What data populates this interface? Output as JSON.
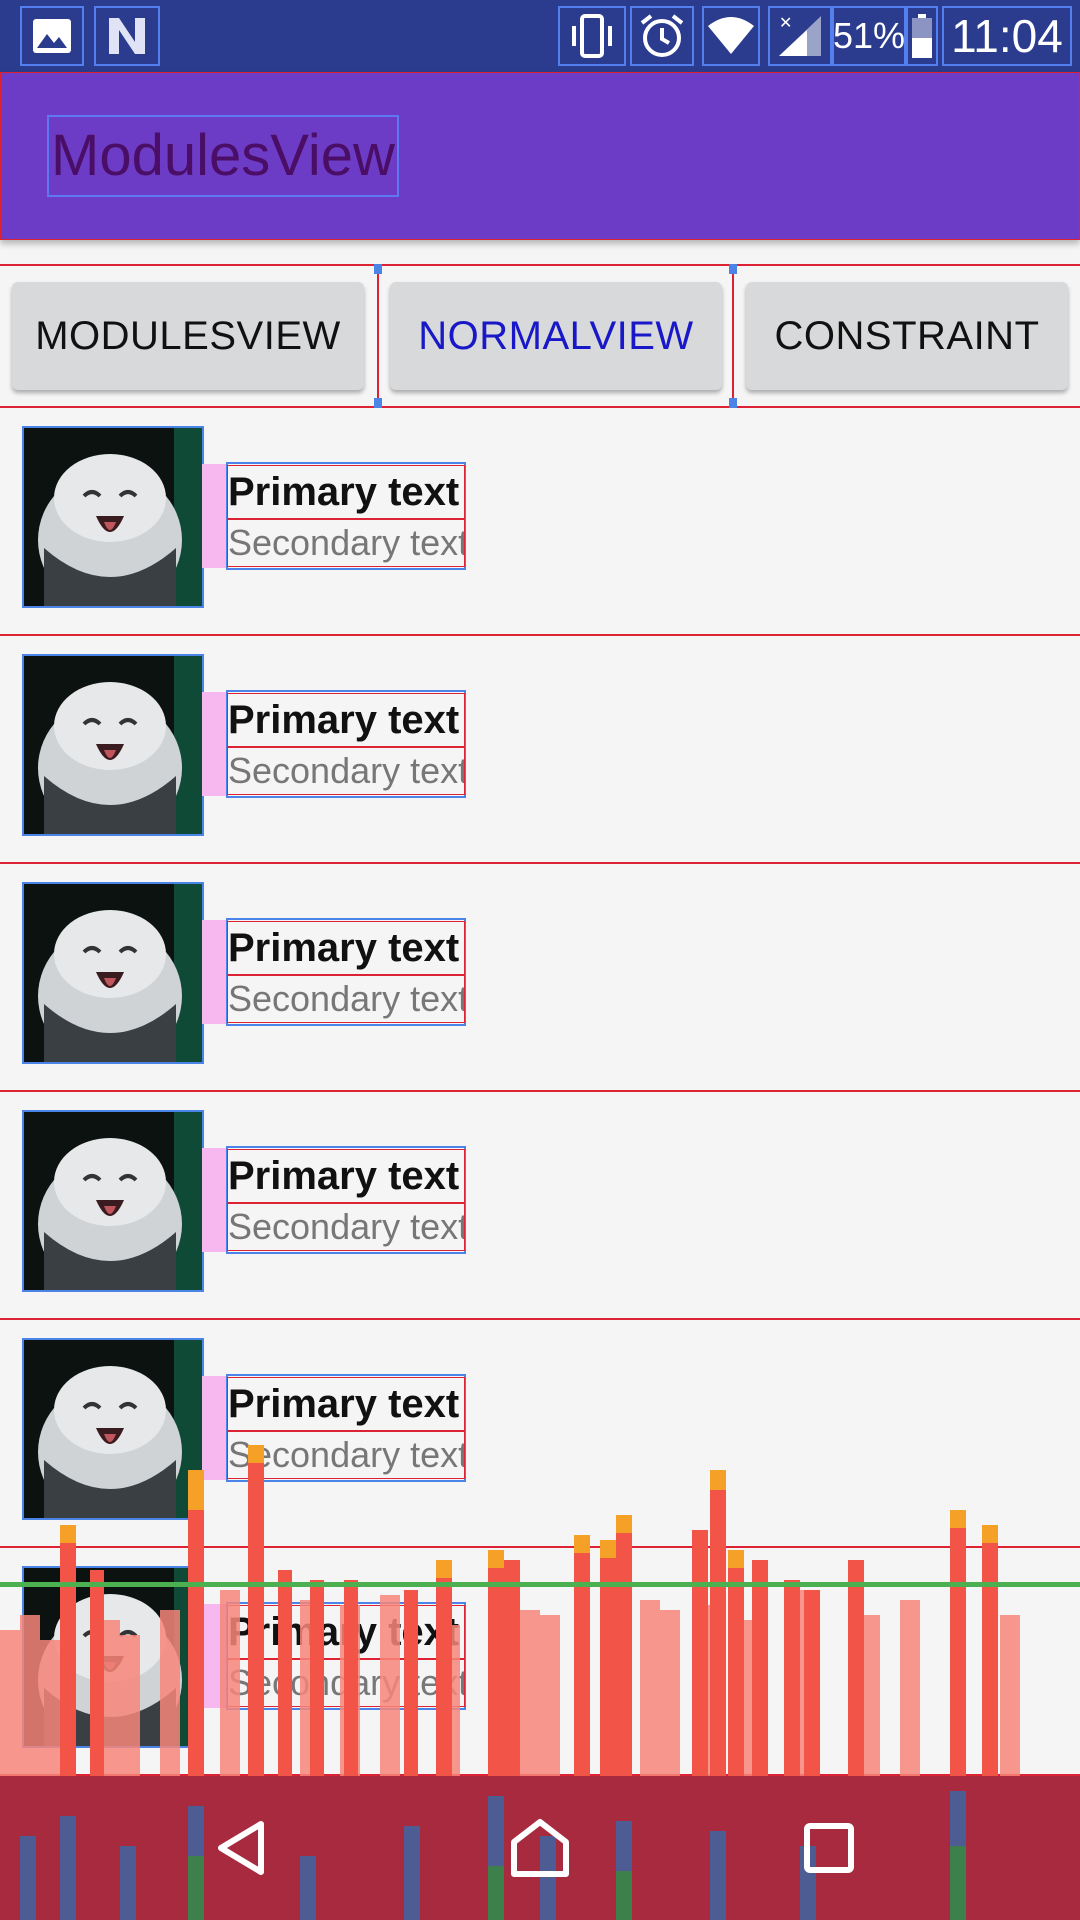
{
  "status_bar": {
    "icons_left": [
      "image-icon",
      "n-icon"
    ],
    "icons_right": [
      "vibrate-icon",
      "alarm-icon",
      "wifi-icon",
      "signal-icon"
    ],
    "battery_percent": "51%",
    "time": "11:04"
  },
  "app_bar": {
    "title": "ModulesView"
  },
  "buttons": [
    {
      "label": "MODULESVIEW"
    },
    {
      "label": "NORMALVIEW"
    },
    {
      "label": "CONSTRAINT"
    }
  ],
  "list": [
    {
      "primary": "Primary text",
      "secondary": "Secondary text"
    },
    {
      "primary": "Primary text",
      "secondary": "Secondary text"
    },
    {
      "primary": "Primary text",
      "secondary": "Secondary text"
    },
    {
      "primary": "Primary text",
      "secondary": "Secondary text"
    },
    {
      "primary": "Primary text",
      "secondary": "Secondary text"
    },
    {
      "primary": "Primary text",
      "secondary": "Secondary text"
    }
  ],
  "nav_bar": {
    "icons": [
      "back-icon",
      "home-icon",
      "recents-icon"
    ]
  },
  "colors": {
    "status_bar": "#2b3c8f",
    "app_bar": "#6d3cc6",
    "active_button_text": "#1818c8",
    "debug_outline_blue": "#4a84e6",
    "debug_outline_red": "#dd2233",
    "profiler_green": "#4caf50"
  }
}
